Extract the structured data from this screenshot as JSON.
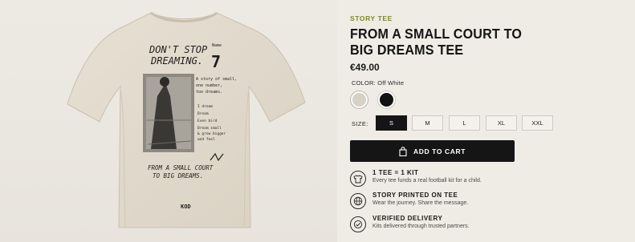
{
  "product": {
    "eyebrow": "STORY TEE",
    "title": "FROM A SMALL COURT TO BIG DREAMS TEE",
    "price": "€49.00",
    "color_label": "COLOR:",
    "color_value": "Off White",
    "swatches": [
      {
        "name": "Off White",
        "hex": "#d8d0c2"
      },
      {
        "name": "Black",
        "hex": "#121212"
      }
    ],
    "size_label": "SIZE:",
    "sizes": [
      "S",
      "M",
      "L",
      "XL",
      "XXL"
    ],
    "selected_size": "S",
    "add_to_cart": "ADD TO CART"
  },
  "features": [
    {
      "icon": "tshirt-icon",
      "title": "1 TEE = 1 KIT",
      "desc": "Every tee funds a real football kit for a child."
    },
    {
      "icon": "globe-icon",
      "title": "STORY PRINTED ON TEE",
      "desc": "Wear the journey. Share the message."
    },
    {
      "icon": "check-circle-icon",
      "title": "VERIFIED DELIVERY",
      "desc": "Kits delivered through trusted partners."
    }
  ],
  "tee_print": {
    "headline_line1": "DON'T STOP",
    "headline_line2": "DREAMING.",
    "number_label": "Name",
    "number": "7",
    "story_line1": "A story of small,",
    "story_line2": "one number,",
    "story_line3": "too dreams.",
    "note_line1": "I dream",
    "note_line2": "Dream",
    "note_line3": "Even bird",
    "note_line4": "Dream small",
    "note_line5": "& grow bigger",
    "note_line6": "and feel",
    "footer_line1": "FROM A SMALL COURT",
    "footer_line2": "TO BIG DREAMS.",
    "brand": "KOD"
  },
  "colors": {
    "accent": "#7d8a2a",
    "button": "#151515",
    "background": "#efece6",
    "tee": "#e3dccf"
  }
}
